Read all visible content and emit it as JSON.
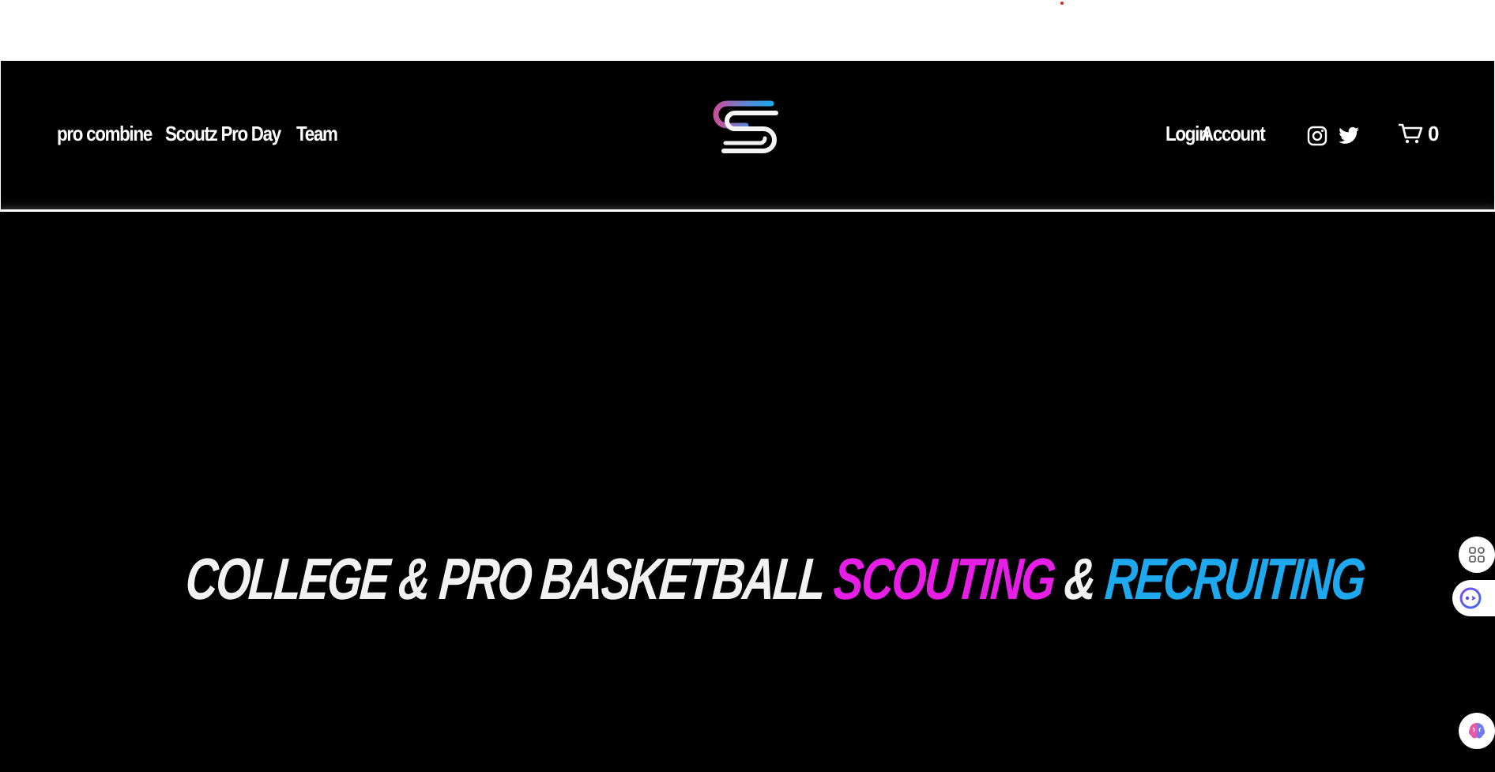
{
  "header": {
    "nav_left": [
      {
        "label": "pro combine"
      },
      {
        "label": "Scoutz Pro Day"
      },
      {
        "label": "Team"
      }
    ],
    "nav_right": [
      {
        "label": "Login"
      },
      {
        "label": "Account"
      }
    ],
    "social": [
      {
        "icon": "instagram-icon"
      },
      {
        "icon": "twitter-icon"
      }
    ],
    "cart": {
      "icon": "cart-icon",
      "count": "0"
    }
  },
  "hero": {
    "headline_part1": "COLLEGE & PRO BASKETBALL ",
    "headline_part2": "SCOUTING",
    "headline_part3": " & ",
    "headline_part4": "RECRUITING"
  },
  "colors": {
    "background": "#000000",
    "pink": "#e61ee6",
    "blue": "#1ea8ee",
    "text": "#ffffff"
  },
  "floating_widgets": [
    {
      "icon": "apps-grid-icon"
    },
    {
      "icon": "assistant-face-icon"
    },
    {
      "icon": "brain-icon"
    }
  ]
}
